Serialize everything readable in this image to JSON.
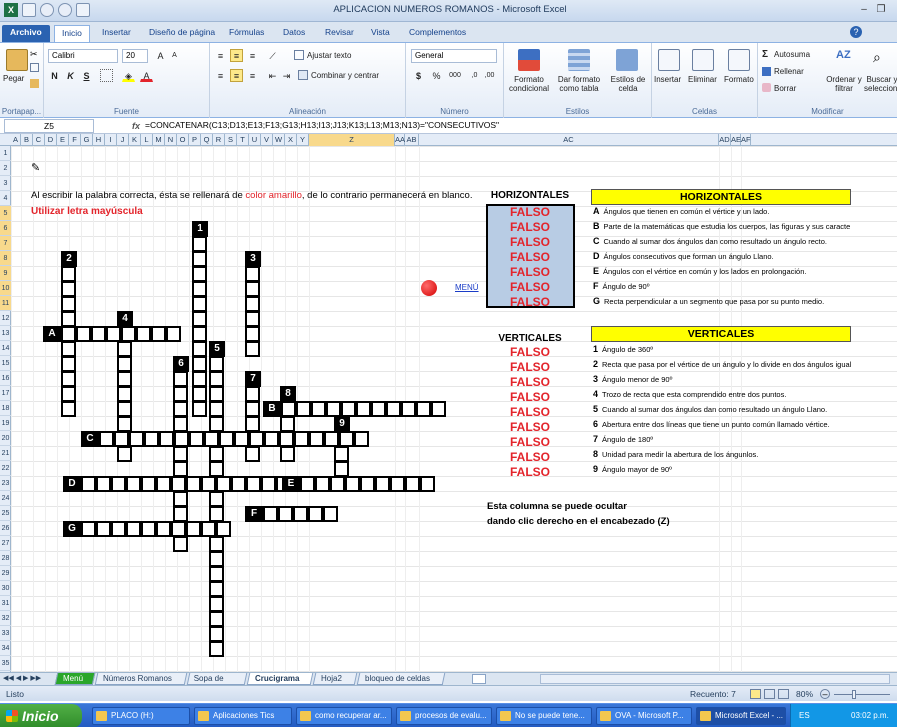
{
  "window": {
    "title": "APLICACION NUMEROS ROMANOS - Microsoft Excel"
  },
  "ribbon": {
    "tabs": [
      "Archivo",
      "Inicio",
      "Insertar",
      "Diseño de página",
      "Fórmulas",
      "Datos",
      "Revisar",
      "Vista",
      "Complementos"
    ],
    "active_tab": "Inicio",
    "clipboard": {
      "paste": "Pegar",
      "group": "Portapap..."
    },
    "font": {
      "name": "Calibri",
      "size": "20",
      "group": "Fuente",
      "bold": "N",
      "italic": "K",
      "underline": "S"
    },
    "alignment": {
      "wrap": "Ajustar texto",
      "merge": "Combinar y centrar",
      "group": "Alineación"
    },
    "number": {
      "format": "General",
      "group": "Número",
      "currency": "$",
      "percent": "%",
      "thousands": "000"
    },
    "styles": {
      "conditional": "Formato condicional",
      "table": "Dar formato como tabla",
      "cell": "Estilos de celda",
      "group": "Estilos"
    },
    "cells": {
      "insert": "Insertar",
      "delete": "Eliminar",
      "format": "Formato",
      "group": "Celdas"
    },
    "editing": {
      "autosum": "Autosuma",
      "fill": "Rellenar",
      "clear": "Borrar",
      "sort": "Ordenar y filtrar",
      "find": "Buscar y seleccionar",
      "group": "Modificar"
    }
  },
  "formula_bar": {
    "name_box": "Z5",
    "fx": "fx",
    "formula": "=CONCATENAR(C13;D13;E13;F13;G13;H13;I13;J13;K13;L13;M13;N13)=\"CONSECUTIVOS\""
  },
  "columns": [
    "A",
    "B",
    "C",
    "D",
    "E",
    "F",
    "G",
    "H",
    "I",
    "J",
    "K",
    "L",
    "M",
    "N",
    "O",
    "P",
    "Q",
    "R",
    "S",
    "T",
    "U",
    "V",
    "W",
    "X",
    "Y",
    "Z",
    "AA",
    "AB",
    "AC",
    "AD",
    "AE",
    "AF"
  ],
  "rows": [
    "1",
    "2",
    "3",
    "4",
    "5",
    "6",
    "7",
    "8",
    "9",
    "10",
    "11",
    "12",
    "13",
    "14",
    "15",
    "16",
    "17",
    "18",
    "19",
    "20",
    "21",
    "22",
    "23",
    "24",
    "25",
    "26",
    "27",
    "28",
    "29",
    "30",
    "31",
    "32",
    "33",
    "34",
    "35"
  ],
  "sheet": {
    "instruction_pre": "Al escribir la palabra correcta, ésta se rellenará de ",
    "instruction_highlight": "color amarillo",
    "instruction_post": ", de lo contrario permanecerá en blanco.",
    "uppercase_note": "Utilizar letra mayúscula",
    "menu_link": "MENÚ",
    "horizontales_label": "HORIZONTALES",
    "verticales_label": "VERTICALES",
    "falso": "FALSO",
    "hide_note_1": "Esta columna se puede ocultar",
    "hide_note_2": "dando clic derecho en el encabezado (Z)",
    "clue_horizontal_title": "HORIZONTALES",
    "clue_vertical_title": "VERTICALES",
    "horizontal_clues": [
      {
        "key": "A",
        "text": "Ángulos que tienen en común el vértice y un lado."
      },
      {
        "key": "B",
        "text": "Parte de la matemáticas que estudia los cuerpos, las figuras y sus caracte"
      },
      {
        "key": "C",
        "text": "Cuando al sumar dos ángulos dan como resultado un ángulo recto."
      },
      {
        "key": "D",
        "text": "Ángulos consecutivos que forman un ángulo Llano."
      },
      {
        "key": "E",
        "text": "Ángulos con el vértice en común y los lados en prolongación."
      },
      {
        "key": "F",
        "text": "Ángulo de 90º"
      },
      {
        "key": "G",
        "text": "Recta perpendicular a un segmento que pasa por su punto medio."
      }
    ],
    "vertical_clues": [
      {
        "key": "1",
        "text": "Ángulo de 360º"
      },
      {
        "key": "2",
        "text": "Recta que pasa por el vértice de un ángulo y lo divide en dos ángulos igual"
      },
      {
        "key": "3",
        "text": "Ángulo menor de 90º"
      },
      {
        "key": "4",
        "text": "Trozo de recta que esta comprendido entre dos puntos."
      },
      {
        "key": "5",
        "text": "Cuando al sumar dos ángulos dan como resultado un ángulo Llano."
      },
      {
        "key": "6",
        "text": "Abertura entre dos líneas que tiene un punto común llamado vértice."
      },
      {
        "key": "7",
        "text": "Ángulo de 180º"
      },
      {
        "key": "8",
        "text": "Unidad para medir la abertura de los ángunlos."
      },
      {
        "key": "9",
        "text": "Ángulo mayor de 90º"
      }
    ],
    "crossword_numbers": [
      "1",
      "2",
      "3",
      "4",
      "5",
      "6",
      "7",
      "8",
      "9"
    ],
    "crossword_letters": [
      "A",
      "B",
      "C",
      "D",
      "E",
      "F",
      "G"
    ]
  },
  "sheet_tabs": [
    "Menú",
    "Números Romanos",
    "Sopa de letras",
    "Crucigrama",
    "Hoja2",
    "bloqueo de celdas"
  ],
  "active_sheet": "Crucigrama",
  "status": {
    "ready": "Listo",
    "count": "Recuento: 7",
    "zoom": "80%"
  },
  "taskbar": {
    "start": "Inicio",
    "items": [
      "PLACO (H:)",
      "Aplicaciones Tics",
      "como recuperar ar...",
      "procesos de evalu...",
      "No se puede tene...",
      "OVA - Microsoft P...",
      "Microsoft Excel - ..."
    ],
    "lang": "ES",
    "time": "03:02 p.m."
  },
  "colors": {
    "falso": "#e3242b",
    "highlight": "#ffff00",
    "selected": "#b8cce4"
  }
}
